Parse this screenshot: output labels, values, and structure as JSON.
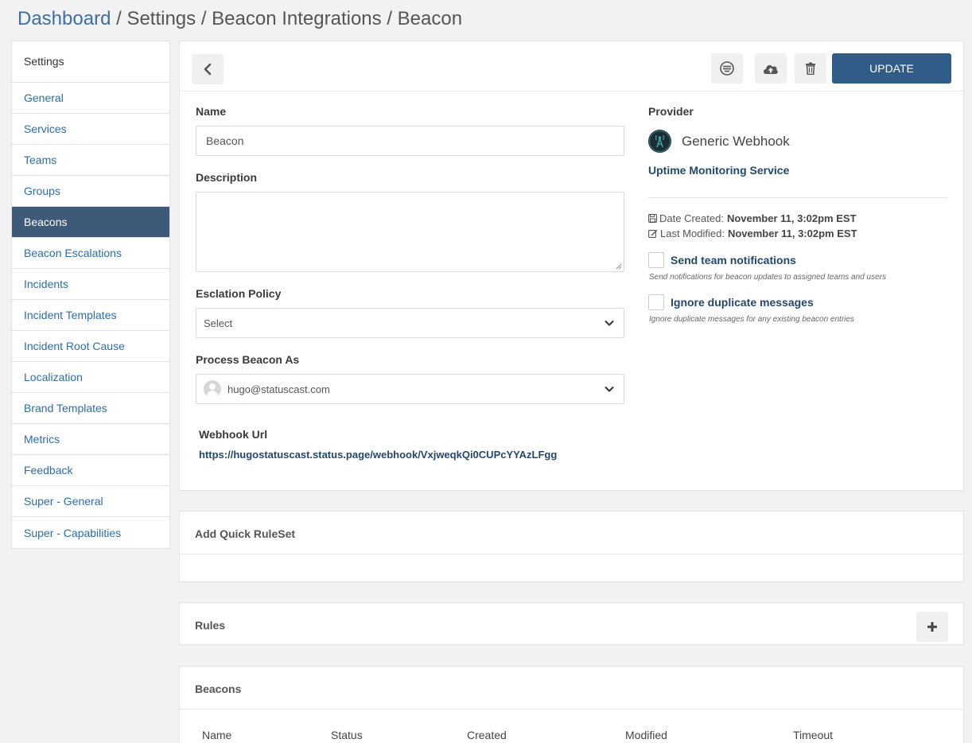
{
  "breadcrumb": {
    "home": "Dashboard",
    "separator": "/",
    "items": [
      "Settings",
      "Beacon Integrations",
      "Beacon"
    ]
  },
  "sidebar": {
    "header": "Settings",
    "active": "Beacons",
    "items": [
      {
        "label": "General"
      },
      {
        "label": "Services"
      },
      {
        "label": "Teams"
      },
      {
        "label": "Groups"
      },
      {
        "label": "Beacons"
      },
      {
        "label": "Beacon Escalations"
      },
      {
        "label": "Incidents"
      },
      {
        "label": "Incident Templates"
      },
      {
        "label": "Incident Root Cause"
      },
      {
        "label": "Localization"
      },
      {
        "label": "Brand Templates"
      },
      {
        "label": "Metrics"
      },
      {
        "label": "Feedback"
      },
      {
        "label": "Super - General"
      },
      {
        "label": "Super - Capabilities"
      }
    ]
  },
  "toolbar": {
    "back_icon": "chevron-left-icon",
    "list_icon": "list-circle-icon",
    "upload_icon": "cloud-upload-icon",
    "delete_icon": "trash-icon",
    "update_label": "UPDATE"
  },
  "form": {
    "name_label": "Name",
    "name_value": "Beacon",
    "description_label": "Description",
    "description_value": "",
    "escalation_label": "Esclation Policy",
    "escalation_value": "Select",
    "process_label": "Process Beacon As",
    "process_value": "hugo@statuscast.com",
    "webhook_label": "Webhook Url",
    "webhook_url": "https://hugostatuscast.status.page/webhook/VxjweqkQi0CUPcYYAzLFgg"
  },
  "provider": {
    "label": "Provider",
    "name": "Generic Webhook",
    "description": "Uptime Monitoring Service",
    "date_created_label": "Date Created:",
    "date_created": "November 11, 3:02pm EST",
    "last_modified_label": "Last Modified:",
    "last_modified": "November 11, 3:02pm EST"
  },
  "options": {
    "send_notifications_label": "Send team notifications",
    "send_notifications_help": "Send notifications for beacon updates to assigned teams and users",
    "send_notifications_checked": false,
    "ignore_duplicates_label": "Ignore duplicate messages",
    "ignore_duplicates_help": "Ignore duplicate messages for any existing beacon entries",
    "ignore_duplicates_checked": false
  },
  "quick_ruleset": {
    "title": "Add Quick RuleSet"
  },
  "rules": {
    "title": "Rules"
  },
  "beacons_table": {
    "title": "Beacons",
    "columns": [
      "Name",
      "Status",
      "Created",
      "Modified",
      "Timeout"
    ]
  },
  "colors": {
    "accent": "#325c88",
    "link": "#2c6ea8",
    "sidebar_active": "#3d5a78"
  }
}
